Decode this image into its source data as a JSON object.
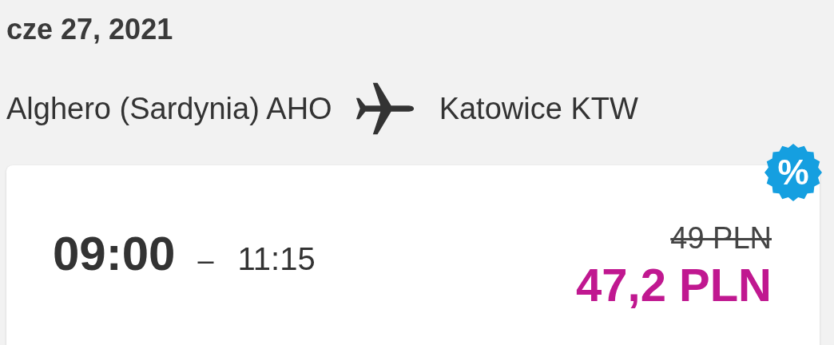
{
  "date": "cze 27, 2021",
  "route": {
    "origin": "Alghero (Sardynia) AHO",
    "destination": "Katowice KTW"
  },
  "flight": {
    "departure": "09:00",
    "separator": "–",
    "arrival": "11:15",
    "old_price": "49 PLN",
    "price": "47,2 PLN",
    "discount_badge": "%"
  }
}
